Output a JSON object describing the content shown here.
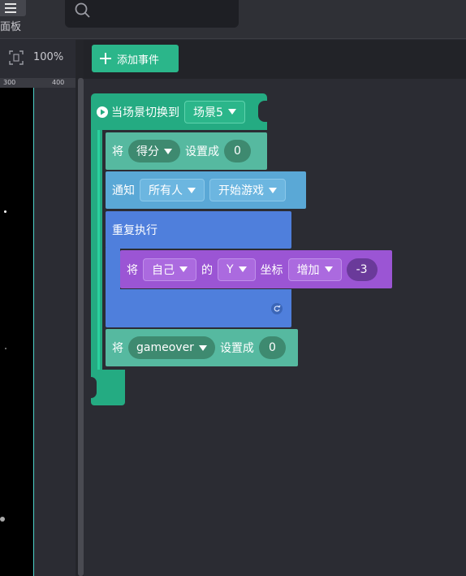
{
  "header": {
    "panel_label": "面板",
    "search_placeholder": ""
  },
  "left_panel": {
    "zoom_level": "100%",
    "ruler_ticks": [
      "300",
      "400"
    ]
  },
  "toolbar": {
    "add_event_label": "添加事件"
  },
  "blocks": {
    "event_hat": {
      "label": "当场景切换到",
      "scene_value": "场景5"
    },
    "set_score": {
      "prefix": "将",
      "var": "得分",
      "mid": "设置成",
      "value": "0"
    },
    "notify": {
      "prefix": "通知",
      "target": "所有人",
      "message": "开始游戏"
    },
    "repeat": {
      "label": "重复执行"
    },
    "change_y": {
      "prefix": "将",
      "sprite": "自己",
      "of": "的",
      "axis": "Y",
      "coord": "坐标",
      "op": "增加",
      "value": "-3"
    },
    "set_gameover": {
      "prefix": "将",
      "var": "gameover",
      "mid": "设置成",
      "value": "0"
    }
  },
  "colors": {
    "event": "#24ab82",
    "variable": "#56b9a0",
    "notify": "#5aa8d6",
    "control": "#4f7fdc",
    "motion": "#9b55d4"
  }
}
